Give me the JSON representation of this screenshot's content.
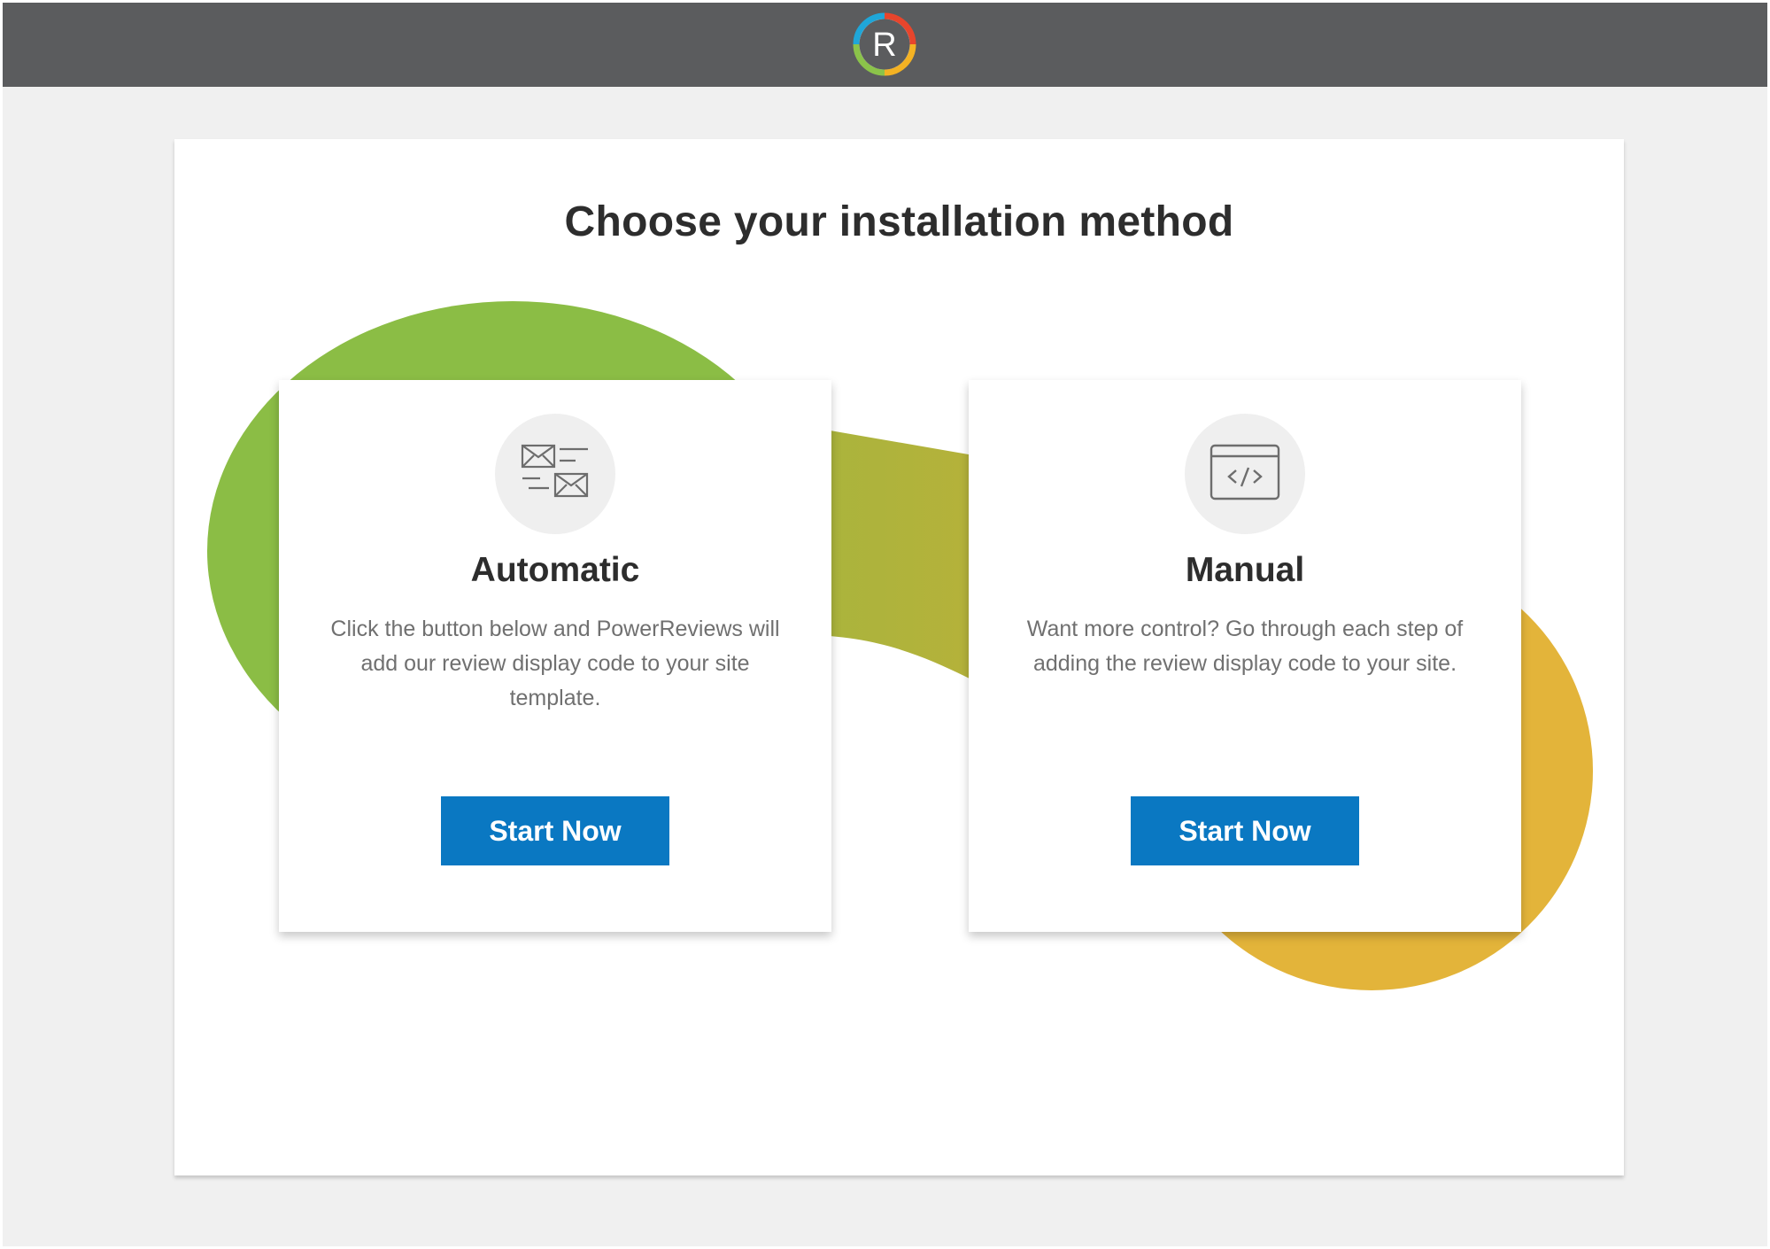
{
  "header": {
    "logo_letter": "R",
    "logo_ring_colors": [
      "#e8452c",
      "#f4b223",
      "#8bc34a",
      "#1fa6d8"
    ]
  },
  "main": {
    "title": "Choose your installation method"
  },
  "decoration_colors": {
    "green": "#8bbd45",
    "olive": "#afb53c",
    "yellow": "#e3b43a"
  },
  "options": [
    {
      "icon": "envelopes-icon",
      "title": "Automatic",
      "description": "Click the button below and PowerReviews will add our review display code to your site template.",
      "button_label": "Start Now"
    },
    {
      "icon": "code-window-icon",
      "title": "Manual",
      "description": "Want more control? Go through each step of adding the review display code to your site.",
      "button_label": "Start Now"
    }
  ],
  "accent_color": "#0a78c2"
}
